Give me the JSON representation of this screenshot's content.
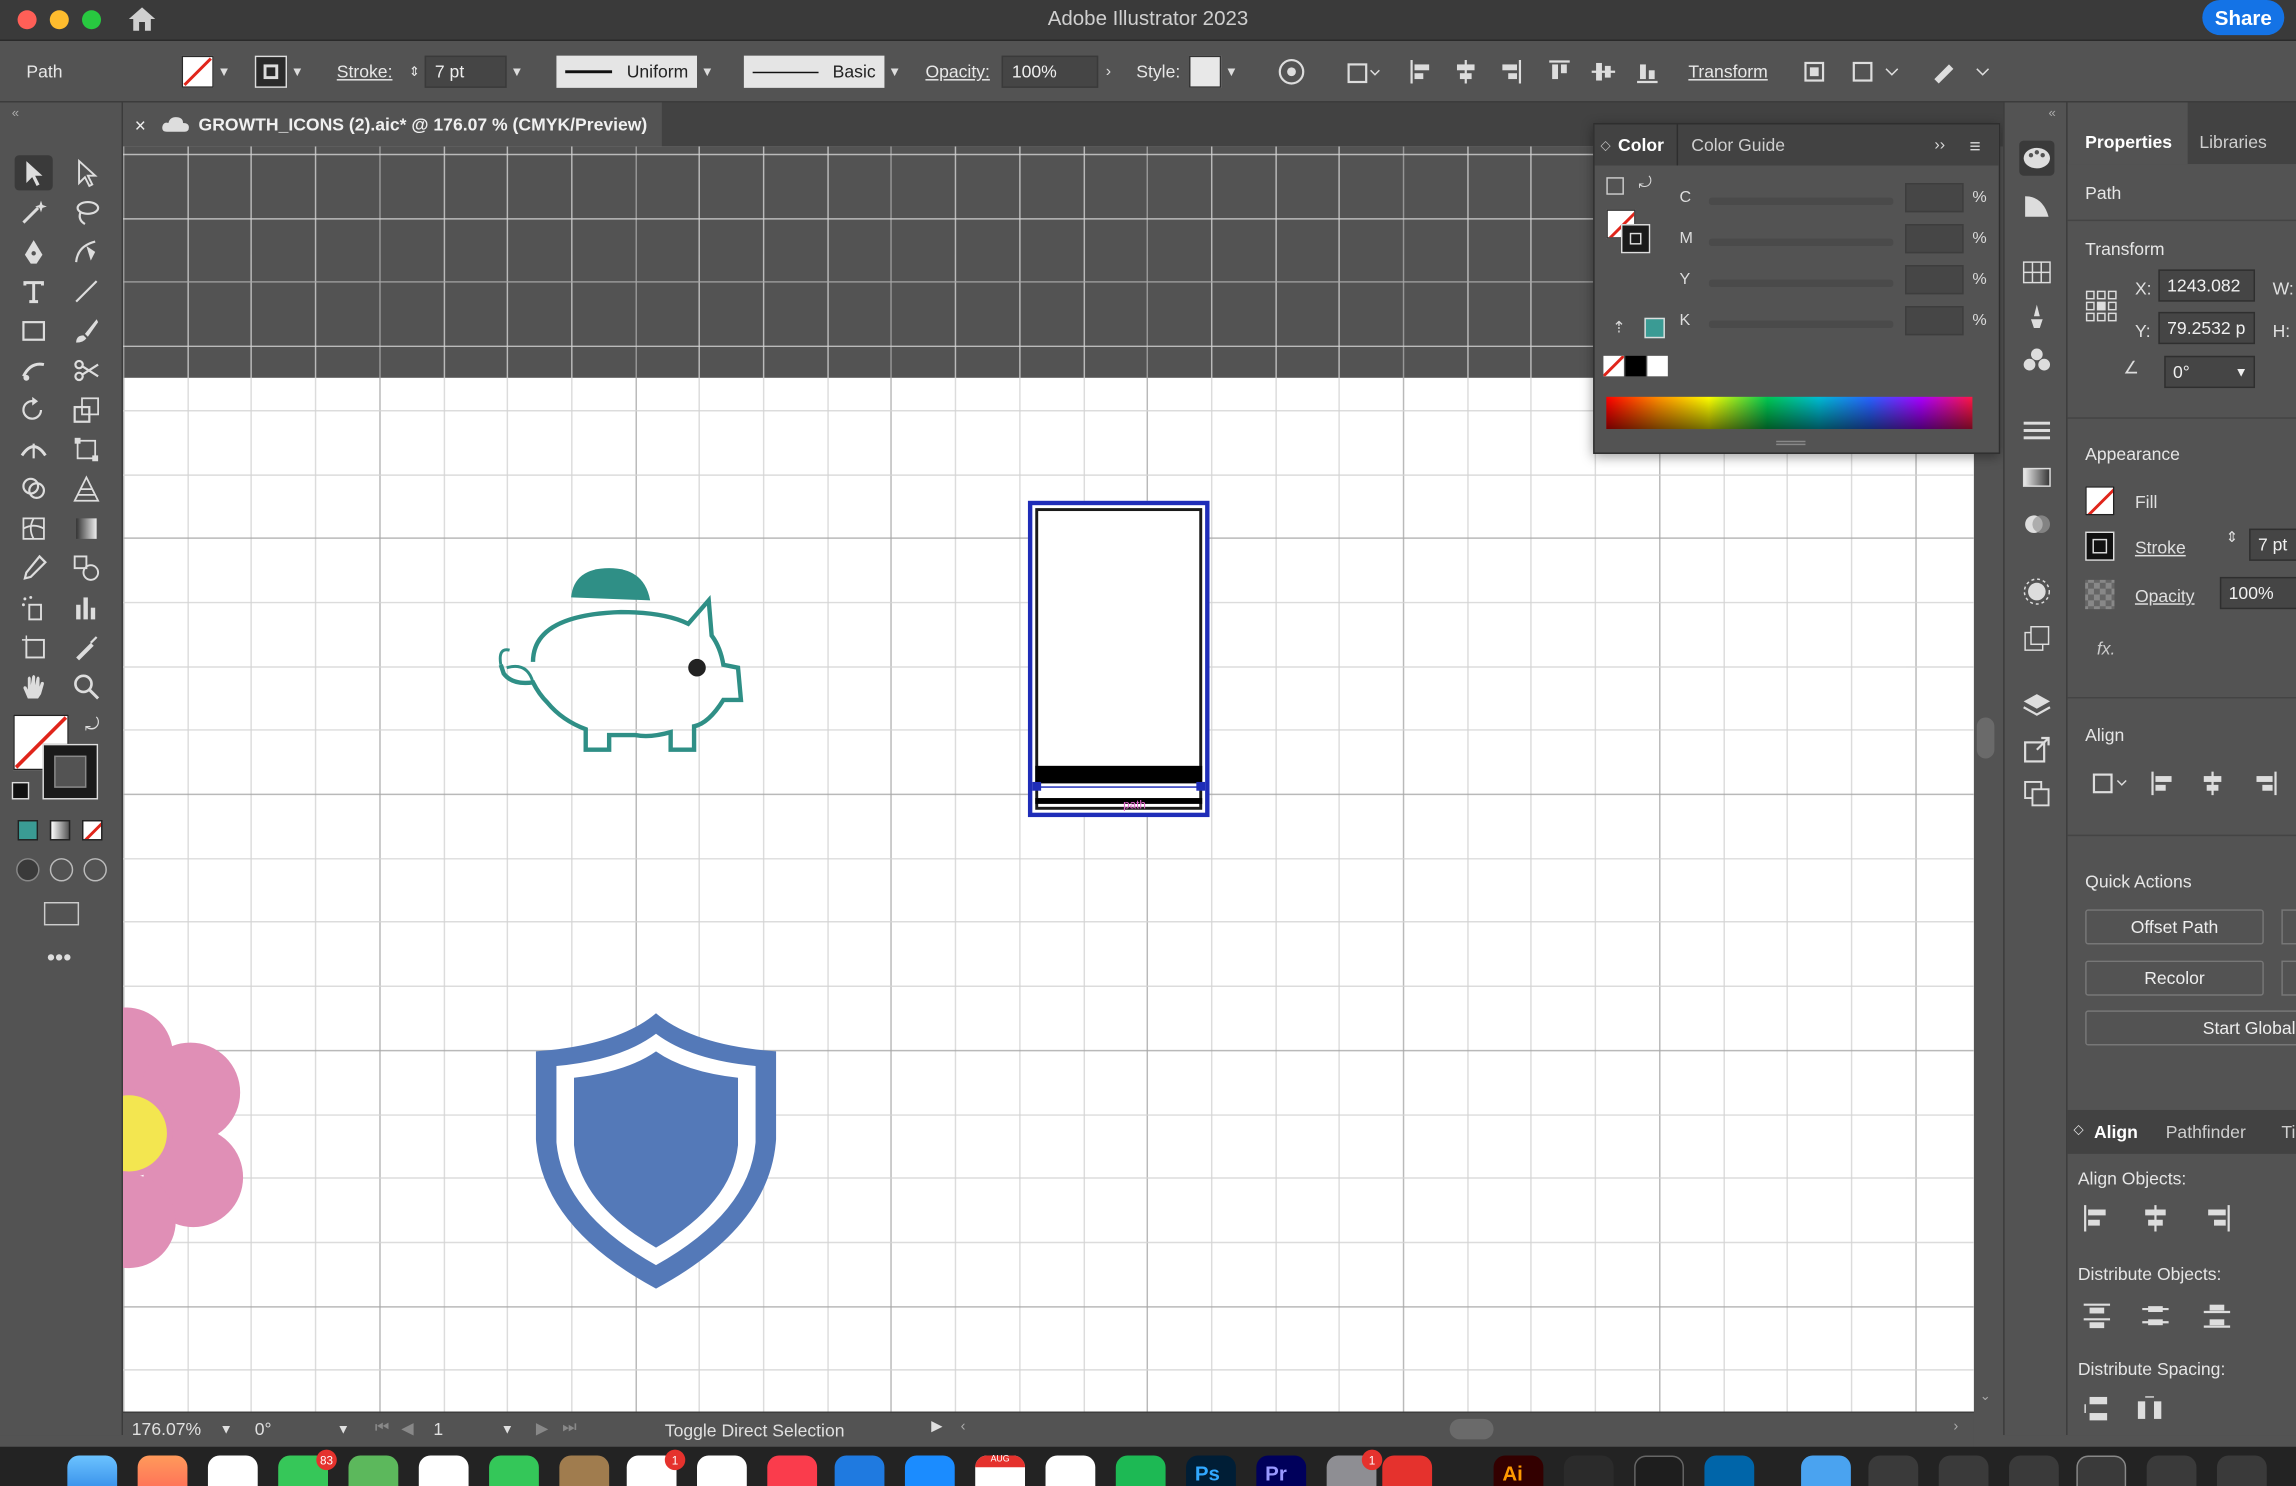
{
  "app_title": "Adobe Illustrator 2023",
  "share_label": "Share",
  "control_bar": {
    "object_type": "Path",
    "stroke_label": "Stroke:",
    "stroke_weight": "7 pt",
    "profile": "Uniform",
    "brush": "Basic",
    "opacity_label": "Opacity:",
    "opacity": "100%",
    "style_label": "Style:",
    "transform_label": "Transform"
  },
  "document_tab": {
    "title": "GROWTH_ICONS (2).aic* @ 176.07 % (CMYK/Preview)"
  },
  "color_panel": {
    "tabs": [
      "Color",
      "Color Guide"
    ],
    "channels": [
      "C",
      "M",
      "Y",
      "K"
    ],
    "unit": "%",
    "swatch_color": "#3a9b94"
  },
  "properties": {
    "tabs": [
      "Properties",
      "Libraries"
    ],
    "selection_type": "Path",
    "transform_title": "Transform",
    "x_label": "X:",
    "x_value": "1243.082",
    "y_label": "Y:",
    "y_value": "79.2532 p",
    "w_label": "W:",
    "h_label": "H:",
    "angle": "0°",
    "appearance_title": "Appearance",
    "fill_label": "Fill",
    "stroke_label": "Stroke",
    "stroke_value": "7 pt",
    "opacity_label": "Opacity",
    "opacity_value": "100%",
    "fx_label": "fx.",
    "align_title": "Align",
    "quick_actions_title": "Quick Actions",
    "quick_actions": [
      "Offset Path",
      "Recolor",
      "Start Global E"
    ],
    "align_tabs": [
      "Align",
      "Pathfinder",
      "Ti"
    ],
    "align_objects": "Align Objects:",
    "distribute_objects": "Distribute Objects:",
    "distribute_spacing": "Distribute Spacing:"
  },
  "status_bar": {
    "zoom": "176.07%",
    "rotation": "0°",
    "artboard": "1",
    "hint": "Toggle Direct Selection"
  },
  "canvas_objects": {
    "piggy_color": "#2f8f86",
    "shield_color": "#5479b8",
    "flower_color": "#e08fb6",
    "flower_center": "#f3e650",
    "selection_color": "#1f2db8",
    "path_tag": "path"
  },
  "dock": {
    "messages_badge": "83",
    "reminders_badge": "1",
    "calendar_month": "AUG",
    "settings_badge": "1",
    "ps_label": "Ps",
    "pr_label": "Pr",
    "ai_label": "Ai"
  }
}
